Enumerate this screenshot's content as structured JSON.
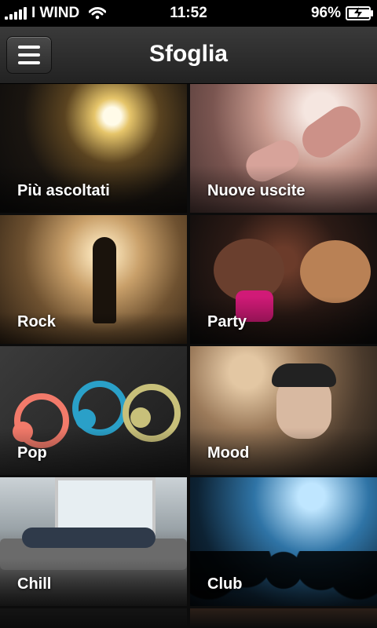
{
  "status_bar": {
    "carrier": "I WIND",
    "time": "11:52",
    "battery_percent_text": "96%",
    "battery_level": 0.96
  },
  "header": {
    "title": "Sfoglia"
  },
  "tiles": [
    {
      "label": "Più ascoltati"
    },
    {
      "label": "Nuove uscite"
    },
    {
      "label": "Rock"
    },
    {
      "label": "Party"
    },
    {
      "label": "Pop"
    },
    {
      "label": "Mood"
    },
    {
      "label": "Chill"
    },
    {
      "label": "Club"
    }
  ],
  "colors": {
    "status_bar_bg": "#000000",
    "header_bg_top": "#3a3a3a",
    "header_bg_bottom": "#222222",
    "text": "#ffffff"
  },
  "icons": {
    "menu": "hamburger-menu-icon",
    "signal": "signal-bars-icon",
    "wifi": "wifi-icon",
    "battery": "battery-charging-icon"
  }
}
